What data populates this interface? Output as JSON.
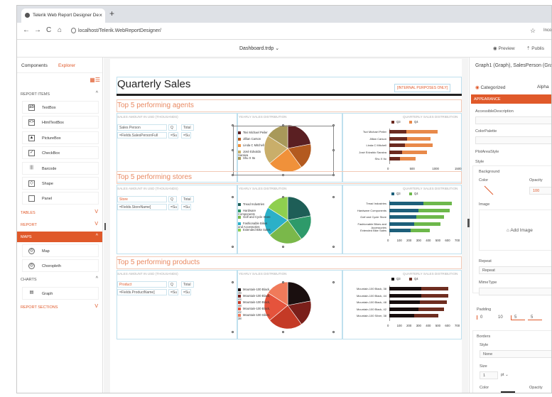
{
  "browser": {
    "tab_title": "Telerik Web Report Designer De",
    "close_glyph": "×",
    "new_tab_glyph": "+",
    "url": "localhost/Telerik.WebReportDesigner/",
    "profile": "Inco"
  },
  "app": {
    "document_name": "Dashboard.trdp",
    "preview_label": "Preview",
    "publish_label": "Publis"
  },
  "left_panel": {
    "tabs": [
      "Components",
      "Explorer"
    ],
    "sections": {
      "report_items": "REPORT ITEMS",
      "tables": "TABLES",
      "report": "REPORT",
      "maps": "MAPS",
      "charts": "CHARTS",
      "report_sections": "REPORT SECTIONS"
    },
    "report_items": [
      "TextBox",
      "HtmlTextBox",
      "PictureBox",
      "CheckBox",
      "Barcode",
      "Shape",
      "Panel"
    ],
    "maps": [
      "Map",
      "Choropleth"
    ],
    "charts": [
      "Graph"
    ]
  },
  "report": {
    "title": "Quarterly Sales",
    "internal_label": "[INTERNAL PURPOSES ONLY]",
    "sections": [
      {
        "heading": "Top 5 performing agents",
        "cap_left": "SALES AMOUNT IN USD (THOUSANDS)",
        "cap_mid": "YEARLY SALES DISTRIBUTION",
        "cap_right": "QUARTERLY SALES DISTRIBUTION",
        "col1": "Sales Person",
        "col2": "Q",
        "col3": "Total",
        "field": "=Fields.SalesPersonFull",
        "field2": "=Su",
        "field3": "=Su",
        "legend": [
          "Tsvi Michael Peiler",
          "Jillian Carson",
          "Linda C Mitchell",
          "José Edvaldo Saraiva",
          "Shu X Ito"
        ],
        "legend_colors": [
          "#5a1f22",
          "#b35a1f",
          "#f0913a",
          "#c9ae6a",
          "#a8995a"
        ],
        "bar_series": [
          "Q3",
          "Q4"
        ],
        "bar_colors": [
          "#6b2a20",
          "#e8894a"
        ],
        "bar_labels": [
          "Tsvi Michael Peiler",
          "Jillian Carson",
          "Linda C Mitchell",
          "José Edvaldo Saraiva",
          "Shu X Ito"
        ],
        "bar_q3": [
          380,
          400,
          350,
          280,
          230
        ],
        "bar_q4": [
          700,
          520,
          610,
          560,
          350
        ],
        "ticks": [
          "0",
          "500",
          "1000",
          "1500"
        ],
        "xmax": 1500
      },
      {
        "heading": "Top 5 performing stores",
        "cap_left": "SALES AMOUNT IN USD (THOUSANDS)",
        "cap_mid": "YEARLY SALES DISTRIBUTION",
        "cap_right": "QUARTERLY SALES DISTRIBUTION",
        "col1": "Store",
        "col2": "Q",
        "col3": "Total",
        "field": "=Fields.StoreName]",
        "field2": "=Su",
        "field3": "=Su",
        "legend": [
          "Tread Industries",
          "Hardware Components",
          "Golf and Cycle Store",
          "Fashionable Bikes and Accessories",
          "Extended Bike Sales"
        ],
        "legend_colors": [
          "#1e5e57",
          "#2e9a6a",
          "#7ab84a",
          "#2bb0c8",
          "#8fcf4f"
        ],
        "bar_series": [
          "Q3",
          "Q4"
        ],
        "bar_colors": [
          "#1d5f7a",
          "#6db84b"
        ],
        "bar_labels": [
          "Tread Industries",
          "Hardware Components",
          "Golf and Cycle Store",
          "Fashionable Bikes and Accessories",
          "Extended Bike Sales"
        ],
        "bar_q3": [
          350,
          300,
          280,
          260,
          220
        ],
        "bar_q4": [
          300,
          330,
          290,
          270,
          200
        ],
        "ticks": [
          "0",
          "100",
          "200",
          "300",
          "400",
          "500",
          "600",
          "700"
        ],
        "xmax": 700
      },
      {
        "heading": "Top 5 performing products",
        "cap_left": "SALES AMOUNT IN USD (THOUSANDS)",
        "cap_mid": "YEARLY SALES DISTRIBUTION",
        "cap_right": "QUARTERLY SALES DISTRIBUTION",
        "col1": "Product",
        "col2": "Q",
        "col3": "Total",
        "field": "=Fields.ProductName]",
        "field2": "=Su",
        "field3": "=Su",
        "legend": [
          "Mountain-100 Black, 38",
          "Mountain-100 Black, 44",
          "Mountain-100 Black, 48",
          "Mountain-100 Black, 42",
          "Mountain-100 Silver, 38"
        ],
        "legend_colors": [
          "#1a0f0f",
          "#7a1f1a",
          "#c43a26",
          "#e5533c",
          "#f07a5a"
        ],
        "bar_series": [
          "Q3",
          "Q4"
        ],
        "bar_colors": [
          "#160d0d",
          "#6e2d20"
        ],
        "bar_labels": [
          "Mountain-100 Black, 38",
          "Mountain-100 Black, 44",
          "Mountain-100 Black, 48",
          "Mountain-100 Black, 42",
          "Mountain-100 Silver, 38"
        ],
        "bar_q3": [
          330,
          330,
          320,
          300,
          260
        ],
        "bar_q4": [
          280,
          280,
          280,
          270,
          250
        ],
        "ticks": [
          "0",
          "100",
          "200",
          "300",
          "400",
          "500",
          "600",
          "700"
        ],
        "xmax": 700
      }
    ]
  },
  "right_panel": {
    "title": "Graph1 (Graph), SalesPerson (Graph)",
    "categorized": "Categorized",
    "alphabetical": "Alpha",
    "group": "APPEARANCE",
    "props": {
      "accessible": "AccessibleDescription",
      "palette": "ColorPalette",
      "plotarea": "PlotAreaStyle",
      "style": "Style",
      "background": "Background",
      "color": "Color",
      "opacity": "Opacity",
      "opacity_val": "100",
      "image": "Image",
      "add_image": "Add Image",
      "repeat": "Repeat",
      "repeat_val": "Repeat",
      "mimetype": "MimeType",
      "padding": "Padding",
      "padding_vals": [
        "0",
        "10",
        "5",
        "5"
      ],
      "borders": "Borders",
      "borders_style": "Style",
      "borders_style_val": "None",
      "size": "Size",
      "size_val": "1",
      "size_unit": "pt",
      "b_color": "Color",
      "b_opacity": "Opacity"
    }
  }
}
